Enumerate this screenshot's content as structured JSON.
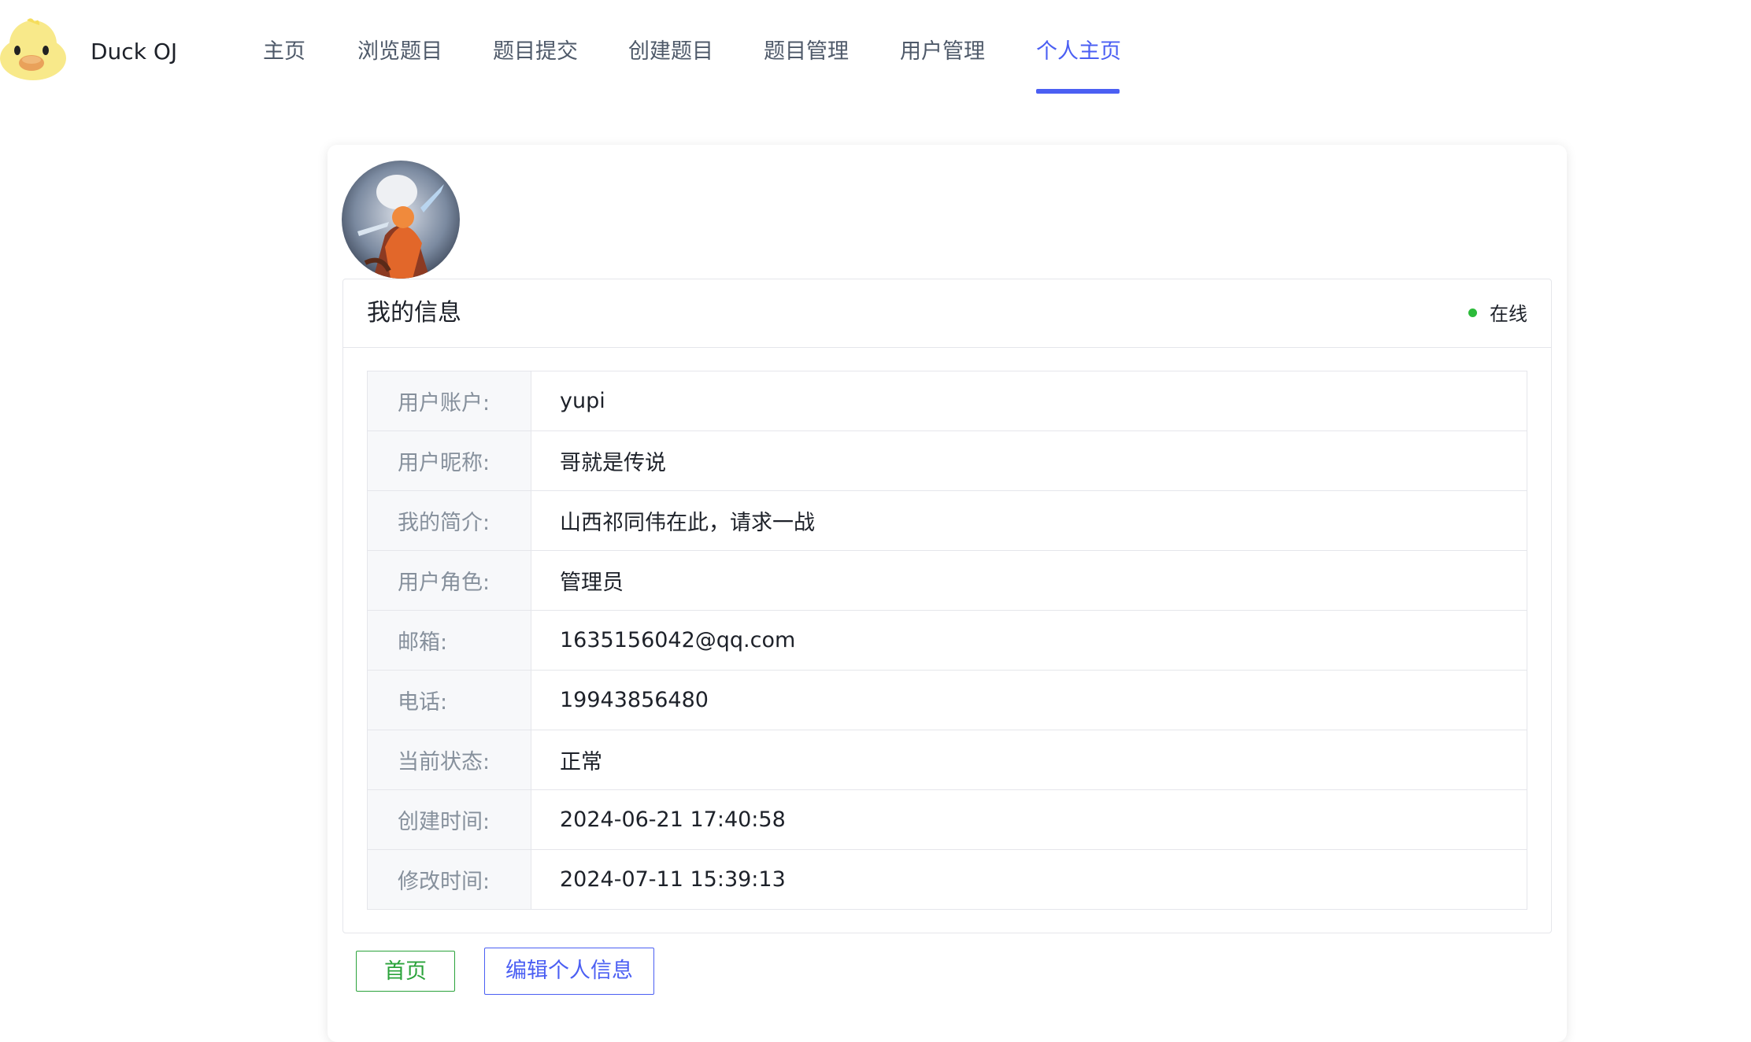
{
  "header": {
    "brand": "Duck OJ",
    "nav": [
      {
        "label": "主页",
        "active": false
      },
      {
        "label": "浏览题目",
        "active": false
      },
      {
        "label": "题目提交",
        "active": false
      },
      {
        "label": "创建题目",
        "active": false
      },
      {
        "label": "题目管理",
        "active": false
      },
      {
        "label": "用户管理",
        "active": false
      },
      {
        "label": "个人主页",
        "active": true
      }
    ]
  },
  "profile": {
    "panel_title": "我的信息",
    "status": "在线",
    "rows": [
      {
        "label": "用户账户:",
        "value": "yupi"
      },
      {
        "label": "用户昵称:",
        "value": "哥就是传说"
      },
      {
        "label": "我的简介:",
        "value": "山西祁同伟在此，请求一战"
      },
      {
        "label": "用户角色:",
        "value": "管理员"
      },
      {
        "label": "邮箱:",
        "value": "1635156042@qq.com"
      },
      {
        "label": "电话:",
        "value": "19943856480"
      },
      {
        "label": "当前状态:",
        "value": "正常"
      },
      {
        "label": "创建时间:",
        "value": "2024-06-21 17:40:58"
      },
      {
        "label": "修改时间:",
        "value": "2024-07-11 15:39:13"
      }
    ]
  },
  "actions": {
    "home_label": "首页",
    "edit_label": "编辑个人信息"
  },
  "colors": {
    "accent": "#4b5ff3",
    "online": "#2cbb3a",
    "home_button": "#2ba33b"
  },
  "icons": {
    "logo": "duck-logo-icon",
    "avatar": "user-avatar-image",
    "status": "online-dot-icon"
  }
}
